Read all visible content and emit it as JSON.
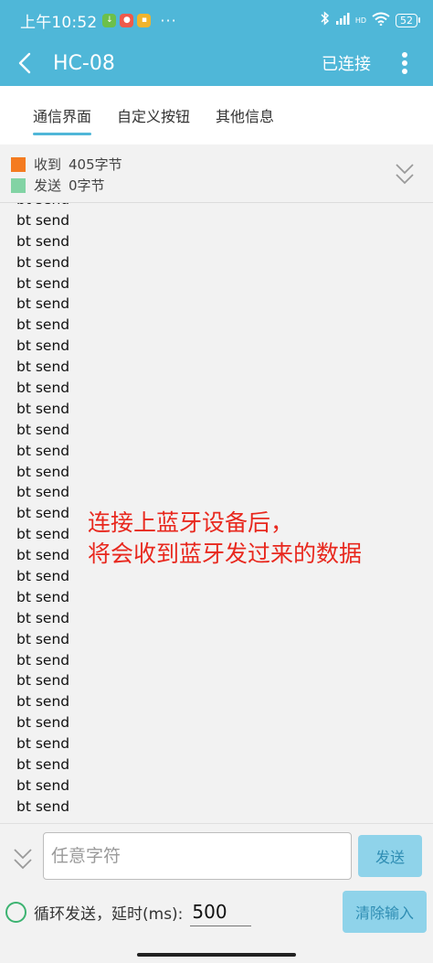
{
  "status_bar": {
    "time": "上午10:52",
    "more": "···",
    "hd": "HD",
    "battery": "52"
  },
  "app_bar": {
    "title": "HC-08",
    "connection_state": "已连接"
  },
  "tabs": [
    {
      "label": "通信界面",
      "active": true
    },
    {
      "label": "自定义按钮",
      "active": false
    },
    {
      "label": "其他信息",
      "active": false
    }
  ],
  "counters": {
    "received_label": "收到",
    "received_count": "405字节",
    "sent_label": "发送",
    "sent_count": "0字节"
  },
  "log": {
    "lines": [
      "bt send",
      "bt send",
      "bt send",
      "bt send",
      "bt send",
      "bt send",
      "bt send",
      "bt send",
      "bt send",
      "bt send",
      "bt send",
      "bt send",
      "bt send",
      "bt send",
      "bt send",
      "bt send",
      "bt send",
      "bt send",
      "bt send",
      "bt send",
      "bt send",
      "bt send",
      "bt send",
      "bt send",
      "bt send",
      "bt send",
      "bt send",
      "bt send",
      "bt send",
      "bt send"
    ]
  },
  "annotation": {
    "line1": "连接上蓝牙设备后，",
    "line2": "将会收到蓝牙发过来的数据"
  },
  "input_area": {
    "message_placeholder": "任意字符",
    "send_label": "发送",
    "loop_label": "循环发送，延时(ms):",
    "delay_value": "500",
    "clear_label": "清除输入"
  },
  "colors": {
    "accent": "#4fb7d8",
    "received_swatch": "#f47b20",
    "sent_swatch": "#82d3a4",
    "annotation_text": "#e8281e"
  }
}
